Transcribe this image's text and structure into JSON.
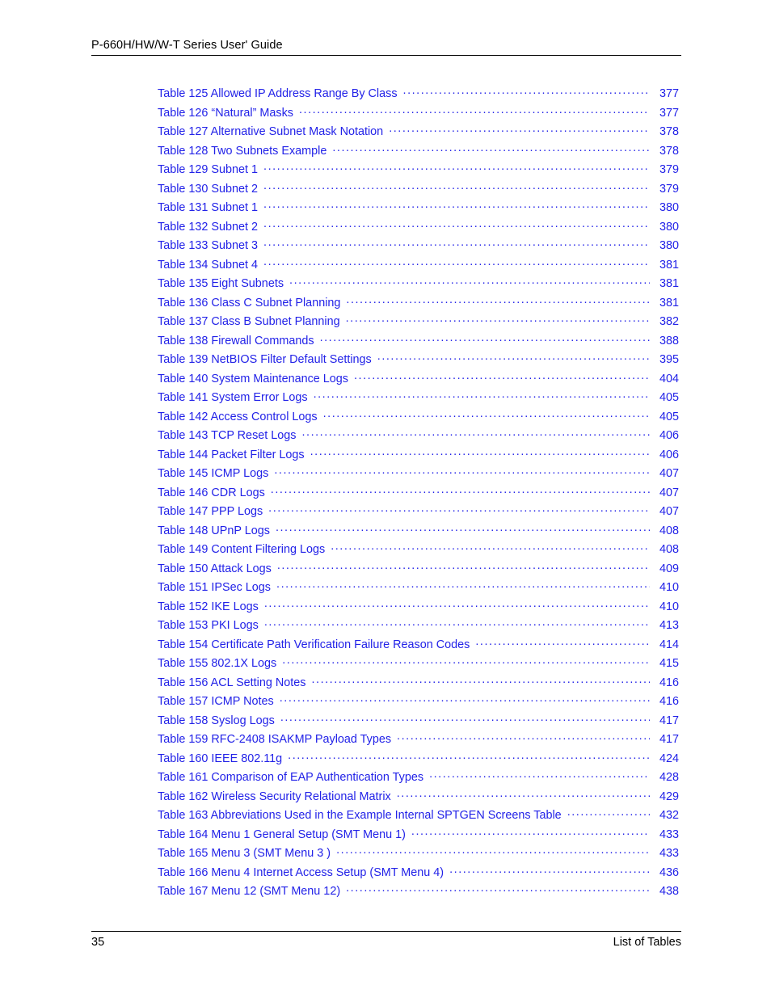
{
  "header": {
    "title": "P-660H/HW/W-T Series User' Guide"
  },
  "footer": {
    "page_number": "35",
    "section_label": "List of Tables"
  },
  "toc": {
    "entries": [
      {
        "label": "Table 125 Allowed IP Address Range By Class",
        "page": "377"
      },
      {
        "label": "Table 126  “Natural” Masks",
        "page": "377"
      },
      {
        "label": "Table 127 Alternative Subnet Mask Notation",
        "page": "378"
      },
      {
        "label": "Table 128 Two Subnets Example",
        "page": "378"
      },
      {
        "label": "Table 129 Subnet 1",
        "page": "379"
      },
      {
        "label": "Table 130 Subnet 2",
        "page": "379"
      },
      {
        "label": "Table 131 Subnet 1",
        "page": "380"
      },
      {
        "label": "Table 132 Subnet 2",
        "page": "380"
      },
      {
        "label": "Table 133 Subnet 3",
        "page": "380"
      },
      {
        "label": "Table 134 Subnet 4",
        "page": "381"
      },
      {
        "label": "Table 135 Eight Subnets",
        "page": "381"
      },
      {
        "label": "Table 136 Class C Subnet Planning",
        "page": "381"
      },
      {
        "label": "Table 137 Class B Subnet Planning",
        "page": "382"
      },
      {
        "label": "Table 138 Firewall Commands",
        "page": "388"
      },
      {
        "label": "Table 139 NetBIOS Filter Default Settings",
        "page": "395"
      },
      {
        "label": "Table 140 System Maintenance Logs",
        "page": "404"
      },
      {
        "label": "Table 141 System Error Logs",
        "page": "405"
      },
      {
        "label": "Table 142 Access Control Logs",
        "page": "405"
      },
      {
        "label": "Table 143 TCP Reset Logs",
        "page": "406"
      },
      {
        "label": "Table 144 Packet Filter Logs",
        "page": "406"
      },
      {
        "label": "Table 145 ICMP Logs",
        "page": "407"
      },
      {
        "label": "Table 146 CDR Logs",
        "page": "407"
      },
      {
        "label": "Table 147 PPP Logs",
        "page": "407"
      },
      {
        "label": "Table 148 UPnP Logs",
        "page": "408"
      },
      {
        "label": "Table 149 Content Filtering Logs",
        "page": "408"
      },
      {
        "label": "Table 150 Attack Logs",
        "page": "409"
      },
      {
        "label": "Table 151 IPSec Logs",
        "page": "410"
      },
      {
        "label": "Table 152 IKE Logs",
        "page": "410"
      },
      {
        "label": "Table 153 PKI Logs",
        "page": "413"
      },
      {
        "label": "Table 154 Certificate Path Verification Failure Reason Codes",
        "page": "414"
      },
      {
        "label": "Table 155 802.1X Logs",
        "page": "415"
      },
      {
        "label": "Table 156 ACL Setting Notes",
        "page": "416"
      },
      {
        "label": "Table 157 ICMP Notes",
        "page": "416"
      },
      {
        "label": "Table 158 Syslog Logs",
        "page": "417"
      },
      {
        "label": "Table 159 RFC-2408 ISAKMP Payload Types",
        "page": "417"
      },
      {
        "label": "Table 160 IEEE 802.11g",
        "page": "424"
      },
      {
        "label": "Table 161 Comparison of EAP Authentication Types",
        "page": "428"
      },
      {
        "label": "Table 162 Wireless Security Relational Matrix",
        "page": "429"
      },
      {
        "label": "Table 163 Abbreviations Used in the Example Internal SPTGEN Screens Table",
        "page": "432"
      },
      {
        "label": "Table 164 Menu 1 General Setup (SMT Menu 1)",
        "page": "433"
      },
      {
        "label": "Table 165 Menu 3 (SMT Menu 3 )",
        "page": "433"
      },
      {
        "label": "Table 166 Menu 4 Internet Access Setup (SMT Menu 4)",
        "page": "436"
      },
      {
        "label": "Table 167 Menu 12 (SMT Menu 12)",
        "page": "438"
      }
    ]
  },
  "colors": {
    "link_blue": "#2222e8",
    "text_black": "#000000",
    "page_background": "#ffffff"
  }
}
